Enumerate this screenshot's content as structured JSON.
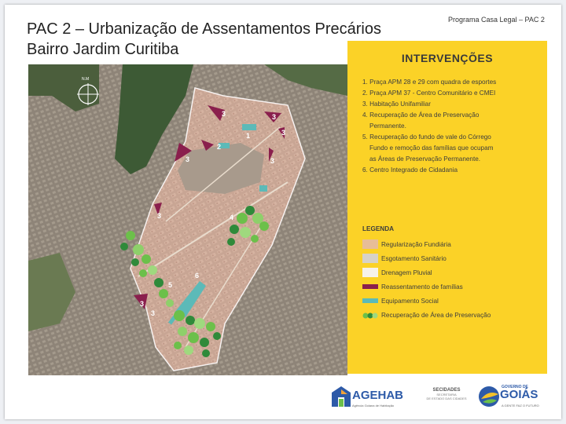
{
  "header": {
    "title_line1": "PAC 2 – Urbanização de Assentamentos Precários",
    "title_line2": "Bairro Jardim Curitiba",
    "program_tag": "Programa Casa Legal – PAC 2"
  },
  "map": {
    "north_label": "N.M",
    "area_numbers": [
      "3",
      "3",
      "3",
      "1",
      "2",
      "3",
      "3",
      "3",
      "4",
      "5",
      "6",
      "3",
      "3"
    ]
  },
  "panel": {
    "title": "INTERVENÇÕES",
    "interventions": [
      "1. Praça APM 28 e 29 com quadra de esportes",
      "2. Praça APM 37 - Centro Comunitário e CMEI",
      "3. Habitação Unifamiliar",
      "4. Recuperação de Área de Preservação",
      "Permanente.",
      "5. Recuperação do fundo de vale do Córrego",
      "Fundo e remoção das famílias que ocupam",
      "as Áreas de Preservação Permanente.",
      "6. Centro Integrado de Cidadania"
    ],
    "legend_title": "LEGENDA",
    "legend": [
      {
        "label": "Regularização Fundiária",
        "color": "#e7bd98"
      },
      {
        "label": "Esgotamento Sanitário",
        "color": "#d7d2c8"
      },
      {
        "label": "Drenagem Pluvial",
        "color": "#f6f2ea"
      },
      {
        "label": "Reassentamento de famílias",
        "color": "#8a1f4d"
      },
      {
        "label": "Equipamento Social",
        "color": "#5cbab8"
      },
      {
        "label": "Recuperação de Área de Preservação",
        "color": "#6cc04a"
      }
    ]
  },
  "logos": {
    "agehab": "AGEHAB",
    "agehab_sub": "Agência Goiana de Habitação",
    "secidades_1": "SECIDADES",
    "secidades_2": "SECRETARIA",
    "secidades_3": "DE ESTADO DAS CIDADES",
    "goias_top": "GOVERNO DE",
    "goias_name": "GOIÁS",
    "goias_sub": "A GENTE FAZ O FUTURO"
  }
}
